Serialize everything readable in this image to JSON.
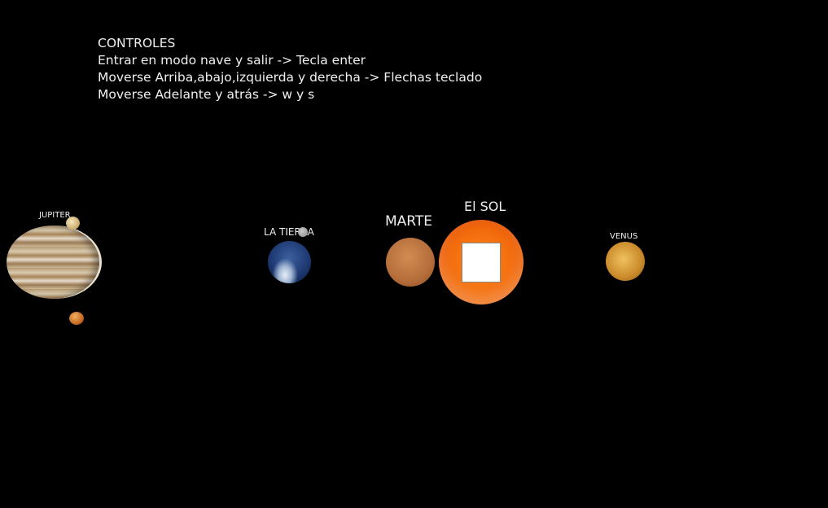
{
  "controls": {
    "title": "CONTROLES",
    "lines": [
      "Entrar en modo nave y salir -> Tecla enter",
      "Moverse Arriba,abajo,izquierda y derecha -> Flechas teclado",
      "Moverse Adelante y atrás -> w y s"
    ]
  },
  "planets": {
    "jupiter": "JUPITER",
    "earth": "LA TIERRA",
    "mars": "MARTE",
    "sun": "El SOL",
    "venus": "VENUS"
  }
}
